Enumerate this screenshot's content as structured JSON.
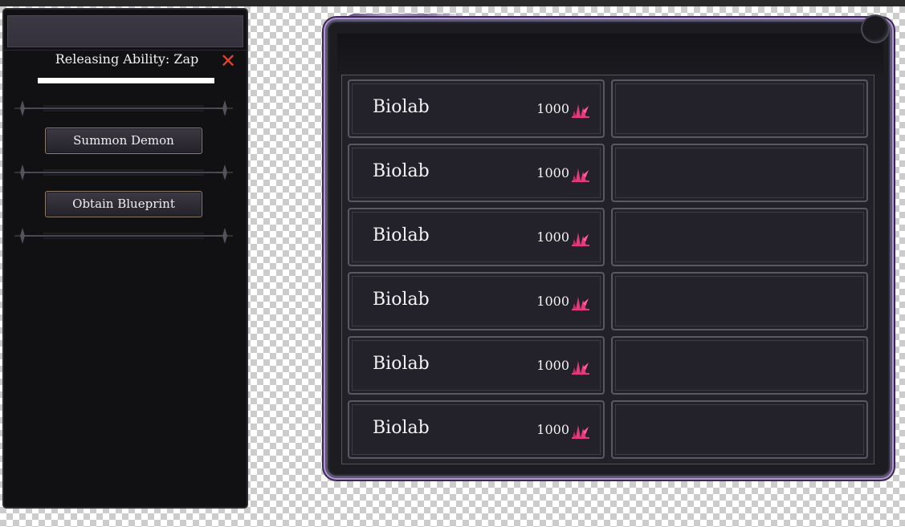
{
  "ability_panel": {
    "title": "Releasing Ability: Zap",
    "progress": 1.0,
    "close_icon": "close-icon",
    "actions": [
      {
        "label": "Summon Demon"
      },
      {
        "label": "Obtain Blueprint"
      }
    ]
  },
  "build_list": {
    "items": [
      {
        "name": "Biolab",
        "cost": "1000",
        "currency_icon": "crystal-icon"
      },
      {
        "name": "Biolab",
        "cost": "1000",
        "currency_icon": "crystal-icon"
      },
      {
        "name": "Biolab",
        "cost": "1000",
        "currency_icon": "crystal-icon"
      },
      {
        "name": "Biolab",
        "cost": "1000",
        "currency_icon": "crystal-icon"
      },
      {
        "name": "Biolab",
        "cost": "1000",
        "currency_icon": "crystal-icon"
      },
      {
        "name": "Biolab",
        "cost": "1000",
        "currency_icon": "crystal-icon"
      }
    ]
  },
  "colors": {
    "close": "#e0442f",
    "crystal": "#e53b7a",
    "frame_accent": "#b394d6"
  }
}
